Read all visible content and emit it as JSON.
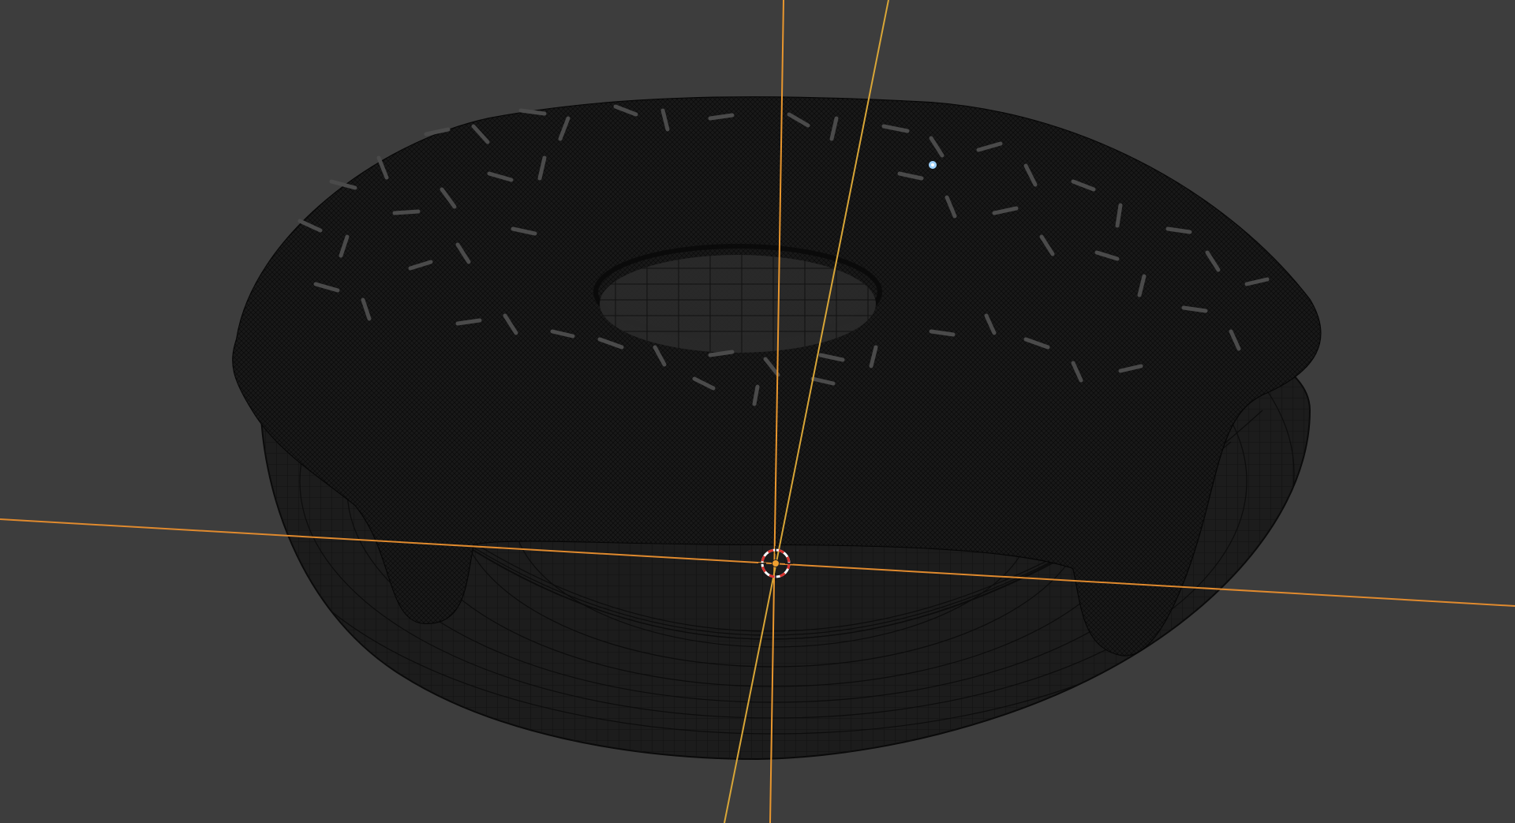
{
  "viewport": {
    "background_color": "#3d3d3d",
    "mode": "wireframe"
  },
  "axes": {
    "x_axis_color": "#e08a2e",
    "z_axis_color": "#e8962e",
    "y_axis_color": "#d9a637"
  },
  "object": {
    "name": "donut",
    "wire_color": "#0c0c0c",
    "icing_color": "#141414",
    "sprinkle_color": "#4a4a4a"
  },
  "cursor_3d": {
    "icon": "3d-cursor-icon",
    "ring_color_a": "#d8322e",
    "ring_color_b": "#ffffff"
  },
  "light": {
    "icon": "light-point-icon",
    "color": "#9fd3ff"
  },
  "origin": {
    "icon": "object-origin-icon",
    "color": "#f0a030"
  }
}
